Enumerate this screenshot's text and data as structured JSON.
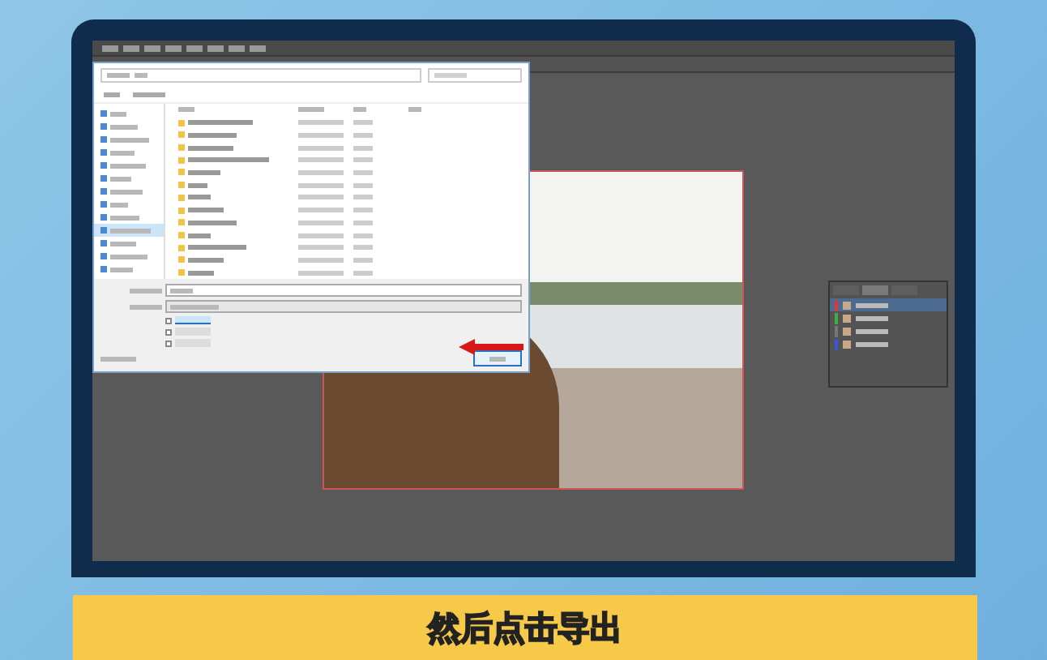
{
  "dialog": {
    "sidebar": [
      {
        "selected": false
      },
      {
        "selected": false
      },
      {
        "selected": false
      },
      {
        "selected": false
      },
      {
        "selected": false
      },
      {
        "selected": false
      },
      {
        "selected": false
      },
      {
        "selected": false
      },
      {
        "selected": false
      },
      {
        "selected": true
      },
      {
        "selected": false
      },
      {
        "selected": false
      },
      {
        "selected": false
      }
    ],
    "options": [
      {
        "checked": false,
        "selected": true
      },
      {
        "checked": false,
        "selected": false
      },
      {
        "checked": false,
        "selected": false
      }
    ]
  },
  "layers_panel": {
    "tabs": [
      {
        "selected": false
      },
      {
        "selected": true
      },
      {
        "selected": false
      }
    ],
    "layers": [
      {
        "color": "#d83a3a",
        "selected": true
      },
      {
        "color": "#3fae4a",
        "selected": false
      },
      {
        "color": "#777777",
        "selected": false
      },
      {
        "color": "#3a56d8",
        "selected": false
      }
    ]
  },
  "caption": "然后点击导出"
}
